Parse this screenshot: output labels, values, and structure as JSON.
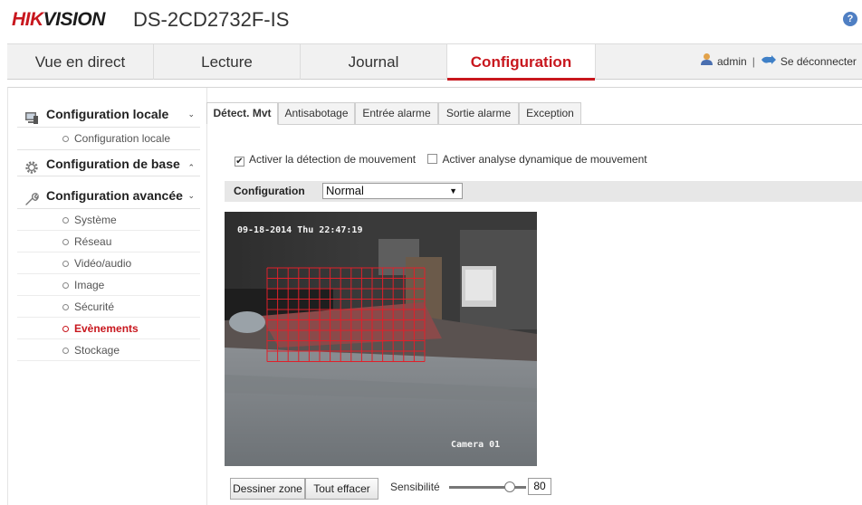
{
  "header": {
    "brand_red": "HIK",
    "brand_dark": "VISION",
    "model": "DS-2CD2732F-IS",
    "help_label": "?"
  },
  "nav": {
    "tabs": [
      {
        "label": "Vue en direct"
      },
      {
        "label": "Lecture"
      },
      {
        "label": "Journal"
      },
      {
        "label": "Configuration",
        "active": true
      }
    ],
    "user": "admin",
    "separator": "|",
    "logout": "Se déconnecter"
  },
  "sidebar": {
    "sections": [
      {
        "label": "Configuration locale",
        "chevron": "⌄",
        "icon": "computer-icon",
        "items": [
          {
            "label": "Configuration locale"
          }
        ]
      },
      {
        "label": "Configuration de base",
        "chevron": "⌃",
        "icon": "gear-icon",
        "items": []
      },
      {
        "label": "Configuration avancée",
        "chevron": "⌄",
        "icon": "wrench-icon",
        "items": [
          {
            "label": "Système"
          },
          {
            "label": "Réseau"
          },
          {
            "label": "Vidéo/audio"
          },
          {
            "label": "Image"
          },
          {
            "label": "Sécurité"
          },
          {
            "label": "Evènements",
            "active": true
          },
          {
            "label": "Stockage"
          }
        ]
      }
    ]
  },
  "subtabs": [
    {
      "label": "Détect. Mvt",
      "active": true
    },
    {
      "label": "Antisabotage"
    },
    {
      "label": "Entrée alarme"
    },
    {
      "label": "Sortie alarme"
    },
    {
      "label": "Exception"
    }
  ],
  "options": {
    "enable_motion": {
      "label": "Activer la détection de mouvement",
      "checked": true
    },
    "enable_dynamic": {
      "label": "Activer analyse dynamique de mouvement",
      "checked": false
    }
  },
  "config": {
    "label": "Configuration",
    "selected": "Normal"
  },
  "video": {
    "timestamp": "09-18-2014 Thu 22:47:19",
    "camera_name": "Camera 01",
    "grid_color": "#e0202a"
  },
  "controls": {
    "draw_zone": "Dessiner zone",
    "clear_all": "Tout effacer",
    "sensitivity_label": "Sensibilité",
    "sensitivity_value": "80"
  },
  "colors": {
    "accent": "#c8171e",
    "nav_bg": "#f1f1f1"
  }
}
